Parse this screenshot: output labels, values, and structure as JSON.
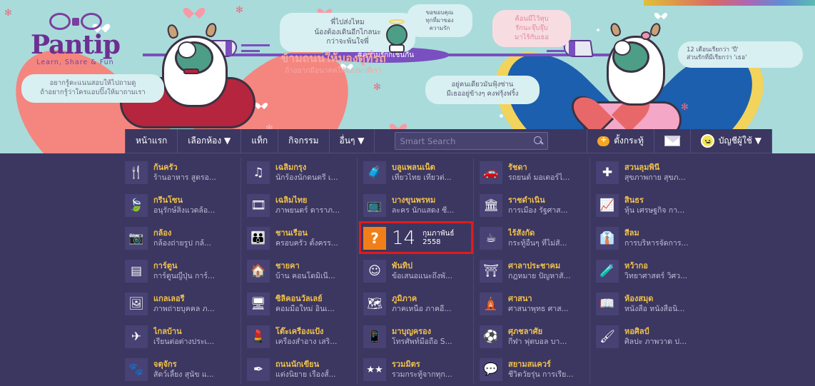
{
  "site": {
    "logo_word": "Pantip",
    "logo_tagline": "Learn, Share & Fun",
    "banner_hashtag": "#ความรักก็เช่นกัน"
  },
  "banner": {
    "bubbles": [
      {
        "id": "b1",
        "text": "อยากรู้คะแนนสอบให้ไปถามดู\nถ้าอยากรู้ว่าใครแอบปิ๊งให้มาถามเรา"
      },
      {
        "id": "b2",
        "text": "พี่ไปส่งไหม\nน้องต้องเดินอีกไกลนะ\nกว่าจะพ้นใจพี่"
      },
      {
        "id": "b3",
        "text": "ขอขอบคุณ\nทุกที่มาของ\nความรัก"
      },
      {
        "id": "b4",
        "text": "ค้อนมีไว้ทุบ\nรักนะจุ๊บจุ๊บ\nมาไร้กับเธอ"
      },
      {
        "id": "b5",
        "text": "อยู่คนเดียวมันฟุ้งซ่าน\nมีเธออยู่ข้างๆ คงฟรุ้งฟริ้ง"
      },
      {
        "id": "b6",
        "text": "12 เดือนเรียกว่า 'ปี'\nส่วนรักที่มีเรียกว่า 'เธอ'"
      }
    ],
    "center_text_big": "ข้ามถนนให้มองดูที่รถ",
    "center_text_small": "ถ้าอยากมีอนาคตให้มองมาที่เรา"
  },
  "nav": {
    "items": [
      {
        "label": "หน้าแรก",
        "caret": false,
        "name": "nav-home"
      },
      {
        "label": "เลือกห้อง ▼",
        "caret": true,
        "name": "nav-rooms"
      },
      {
        "label": "แท็ก",
        "caret": false,
        "name": "nav-tags"
      },
      {
        "label": "กิจกรรม",
        "caret": false,
        "name": "nav-activity"
      },
      {
        "label": "อื่นๆ ▼",
        "caret": true,
        "name": "nav-more"
      }
    ],
    "search_placeholder": "Smart Search",
    "search_value": "",
    "post_label": "ตั้งกระทู้",
    "account_label": "บัญชีผู้ใช้ ▼"
  },
  "date_widget": {
    "day": "14",
    "month": "กุมภาพันธ์",
    "year": "2558",
    "icon": "question-mark",
    "highlight_color": "#e01b1b",
    "icon_bg": "#f07f1a"
  },
  "rooms": {
    "columns": [
      [
        {
          "name": "ก้นครัว",
          "desc": "ร้านอาหาร สูตรอ...",
          "icon": "cutlery-icon",
          "glyph": "🍴"
        },
        {
          "name": "กรีนโซน",
          "desc": "อนุรักษ์สิ่งแวดล้อ...",
          "icon": "leaf-icon",
          "glyph": "🍃"
        },
        {
          "name": "กล้อง",
          "desc": "กล้องถ่ายรูป กล้...",
          "icon": "camera-icon",
          "glyph": "📷"
        },
        {
          "name": "การ์ตูน",
          "desc": "การ์ตูนญี่ปุ่น การ์...",
          "icon": "comic-icon",
          "glyph": "▤"
        },
        {
          "name": "แกลเลอรี่",
          "desc": "ภาพถ่ายบุคคล ภ...",
          "icon": "picture-icon",
          "glyph": "🖼"
        },
        {
          "name": "ไกลบ้าน",
          "desc": "เรียนต่อต่างประเ...",
          "icon": "airplane-icon",
          "glyph": "✈"
        },
        {
          "name": "จตุจักร",
          "desc": "สัตว์เลี้ยง สุนัข แ...",
          "icon": "pets-icon",
          "glyph": "🐾"
        }
      ],
      [
        {
          "name": "เฉลิมกรุง",
          "desc": "นักร้องนักดนตรี เ...",
          "icon": "music-note-icon",
          "glyph": "♫"
        },
        {
          "name": "เฉลิมไทย",
          "desc": "ภาพยนตร์ ดาราภ...",
          "icon": "film-strip-icon",
          "glyph": "🎞"
        },
        {
          "name": "ชานเรือน",
          "desc": "ครอบครัว ตั้งครร...",
          "icon": "family-icon",
          "glyph": "👪"
        },
        {
          "name": "ชายคา",
          "desc": "บ้าน คอนโดมิเนี...",
          "icon": "house-icon",
          "glyph": "🏠"
        },
        {
          "name": "ซิลิคอนวัลเลย์",
          "desc": "คอมมือใหม่ อินเ...",
          "icon": "computer-icon",
          "glyph": "🖥"
        },
        {
          "name": "โต๊ะเครื่องแป้ง",
          "desc": "เครื่องสำอาง เสริ...",
          "icon": "cosmetics-icon",
          "glyph": "💄"
        },
        {
          "name": "ถนนนักเขียน",
          "desc": "แต่งนิยาย เรื่องสั้...",
          "icon": "fountain-pen-icon",
          "glyph": "✒"
        }
      ],
      [
        {
          "name": "บลูแพลนเน็ต",
          "desc": "เที่ยวไทย เที่ยวต่...",
          "icon": "luggage-icon",
          "glyph": "🧳"
        },
        {
          "name": "บางขุนพรหม",
          "desc": "ละคร นักแสดง ซี...",
          "icon": "television-icon",
          "glyph": "📺"
        },
        {
          "name": "พันทิป",
          "desc": "ข้อเสนอแนะถึงพั...",
          "icon": "smiley-face-icon",
          "glyph": "☺"
        },
        {
          "name": "ภูมิภาค",
          "desc": "ภาคเหนือ ภาคอี...",
          "icon": "thailand-map-icon",
          "glyph": "🗺"
        },
        {
          "name": "มาบุญครอง",
          "desc": "โทรศัพท์มือถือ S...",
          "icon": "mobile-phone-icon",
          "glyph": "📱"
        },
        {
          "name": "รวมมิตร",
          "desc": "รวมกระทู้จากทุก...",
          "icon": "stars-icon",
          "glyph": "★★"
        }
      ],
      [
        {
          "name": "รัชดา",
          "desc": "รถยนต์ มอเตอร์ไ...",
          "icon": "car-bike-icon",
          "glyph": "🚗"
        },
        {
          "name": "ราชดำเนิน",
          "desc": "การเมือง รัฐศาส...",
          "icon": "parliament-icon",
          "glyph": "🏛"
        },
        {
          "name": "ไร้สังกัด",
          "desc": "กระทู้อื่นๆ ที่ไม่สั...",
          "icon": "coffee-cup-icon",
          "glyph": "☕"
        },
        {
          "name": "ศาลาประชาคม",
          "desc": "กฎหมาย ปัญหาสั...",
          "icon": "pavilion-icon",
          "glyph": "⛩"
        },
        {
          "name": "ศาสนา",
          "desc": "ศาสนาพุทธ ศาส...",
          "icon": "temple-icon",
          "glyph": "🛕"
        },
        {
          "name": "ศุภชลาศัย",
          "desc": "กีฬา ฟุตบอล บา...",
          "icon": "sports-ball-icon",
          "glyph": "⚽"
        },
        {
          "name": "สยามสแควร์",
          "desc": "ชีวิตวัยรุ่น การเรีย...",
          "icon": "speech-bubbles-icon",
          "glyph": "💬"
        }
      ],
      [
        {
          "name": "สวนลุมพินี",
          "desc": "สุขภาพกาย สุขภ...",
          "icon": "medical-cross-icon",
          "glyph": "✚"
        },
        {
          "name": "สินธร",
          "desc": "หุ้น เศรษฐกิจ กา...",
          "icon": "stock-chart-icon",
          "glyph": "📈"
        },
        {
          "name": "สีลม",
          "desc": "การบริหารจัดการ...",
          "icon": "businessman-icon",
          "glyph": "👔"
        },
        {
          "name": "หว้ากอ",
          "desc": "วิทยาศาสตร์ วิศว...",
          "icon": "test-tube-icon",
          "glyph": "🧪"
        },
        {
          "name": "ห้องสมุด",
          "desc": "หนังสือ หนังสือนิ...",
          "icon": "open-book-icon",
          "glyph": "📖"
        },
        {
          "name": "หอศิลป์",
          "desc": "ศิลปะ ภาพวาด ป...",
          "icon": "paint-brush-icon",
          "glyph": "🖌"
        }
      ]
    ]
  }
}
